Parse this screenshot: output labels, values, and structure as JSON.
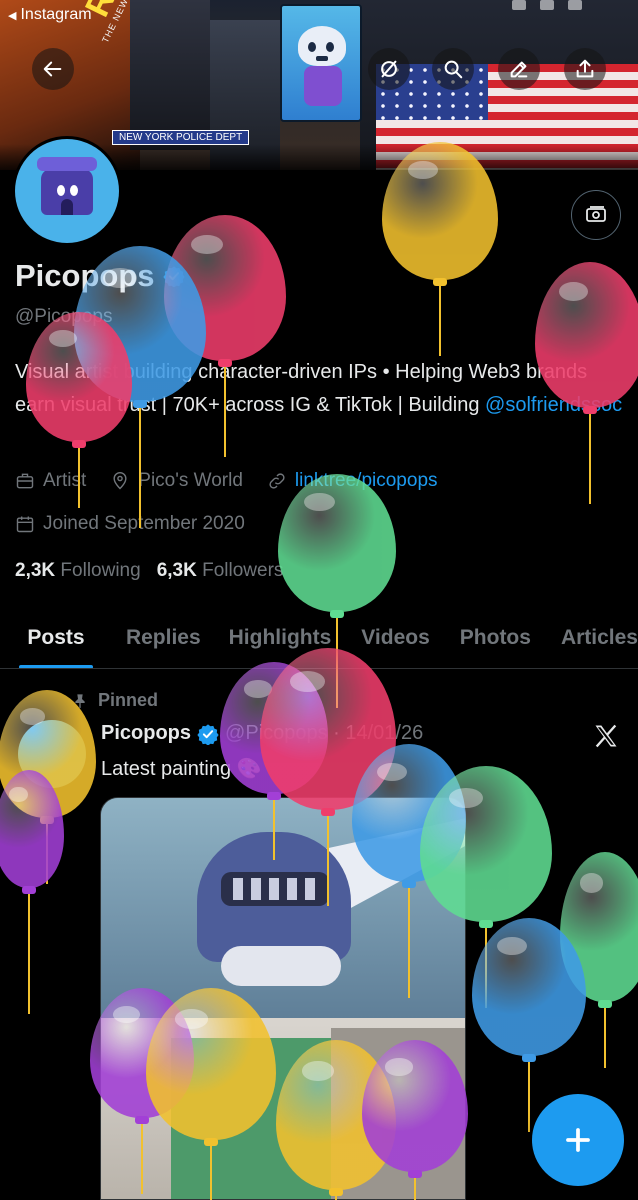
{
  "status_bar": {
    "back_app": "Instagram"
  },
  "banner": {
    "ad_brand": "Rae Sre",
    "ad_subtitle": "THE NEW ALBUM",
    "street_sign": "NEW YORK POLICE DEPT"
  },
  "top_actions": [
    {
      "name": "back-arrow-icon"
    },
    {
      "name": "grok-icon"
    },
    {
      "name": "search-icon"
    },
    {
      "name": "edit-icon"
    },
    {
      "name": "share-icon"
    }
  ],
  "profile": {
    "display_name": "Picopops",
    "handle": "@Picopops",
    "bio_text": "Visual artist building character-driven IPs • Helping Web3 brands earn visual trust | 70K+ across IG & TikTok | Building ",
    "bio_link": "@solfriendssoc",
    "profession": "Artist",
    "location": "Pico's World",
    "website": "linktree/picopops",
    "joined": "Joined September 2020",
    "following_count": "2,3K",
    "following_label": "Following",
    "followers_count": "6,3K",
    "followers_label": "Followers"
  },
  "tabs": [
    "Posts",
    "Replies",
    "Highlights",
    "Videos",
    "Photos",
    "Articles"
  ],
  "post": {
    "pinned_label": "Pinned",
    "author": "Picopops",
    "handle_date": "@Picopops · 14/01/26",
    "text": "Latest painting 🎨"
  },
  "colors": {
    "accent": "#1d9bf0",
    "background": "#000000",
    "text_primary": "#e7e9ea",
    "text_secondary": "#71767b",
    "balloon_yellow": "#f2c12e",
    "balloon_red": "#ef3d6b",
    "balloon_blue": "#3f9be6",
    "balloon_green": "#5fdc92",
    "balloon_purple": "#a23fd6"
  }
}
